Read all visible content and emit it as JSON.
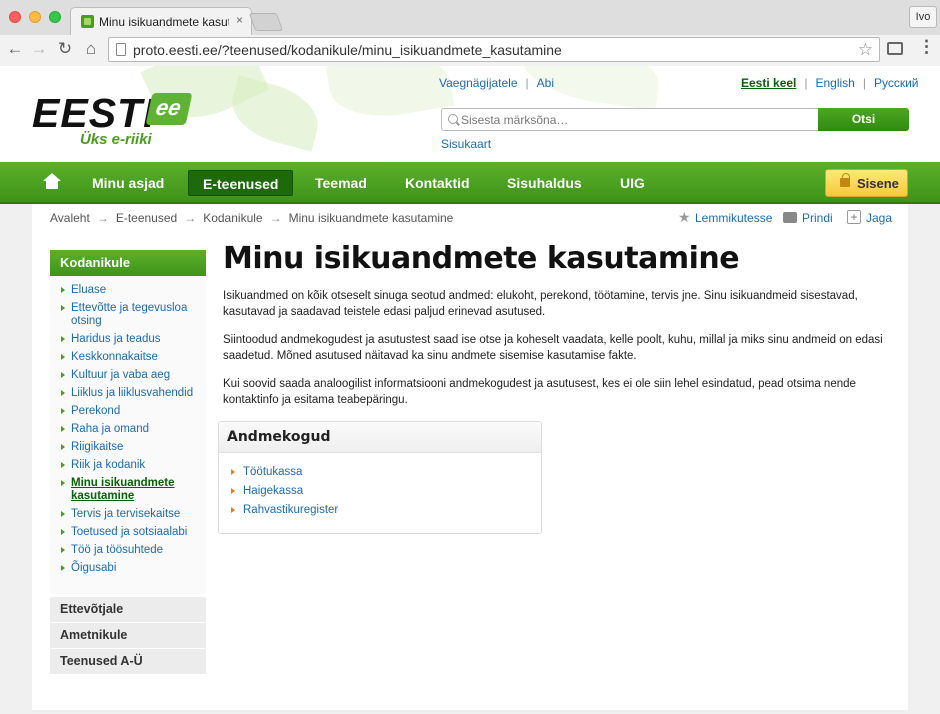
{
  "browser": {
    "tab_title": "Minu isikuandmete kasutam",
    "tab_close": "×",
    "profile": "Ivo",
    "url": "proto.eesti.ee/?teenused/kodanikule/minu_isikuandmete_kasutamine"
  },
  "header": {
    "logo_text": "EESTI",
    "logo_badge": "ee",
    "logo_tagline": "Üks e-riiki",
    "links_left": [
      "Vaegnägijatele",
      "Abi"
    ],
    "languages": [
      "Eesti keel",
      "English",
      "Русский"
    ],
    "search_placeholder": "Sisesta märksõna…",
    "search_button": "Otsi",
    "sitemap": "Sisukaart"
  },
  "nav": {
    "items": [
      "Minu asjad",
      "E-teenused",
      "Teemad",
      "Kontaktid",
      "Sisuhaldus",
      "UIG"
    ],
    "enter": "Sisene"
  },
  "breadcrumb": [
    "Avaleht",
    "E-teenused",
    "Kodanikule",
    "Minu isikuandmete kasutamine"
  ],
  "breadcrumb_sep": "→",
  "utilities": [
    "Lemmikutesse",
    "Prindi",
    "Jaga"
  ],
  "sidebar": {
    "heading": "Kodanikule",
    "items": [
      "Eluase",
      "Ettevõtte ja tegevusloa otsing",
      "Haridus ja teadus",
      "Keskkonnakaitse",
      "Kultuur ja vaba aeg",
      "Liiklus ja liiklusvahendid",
      "Perekond",
      "Raha ja omand",
      "Riigikaitse",
      "Riik ja kodanik",
      "Minu isikuandmete kasutamine",
      "Tervis ja tervisekaitse",
      "Toetused ja sotsiaalabi",
      "Töö ja töösuhtede",
      "Õigusabi"
    ],
    "sections": [
      "Ettevõtjale",
      "Ametnikule",
      "Teenused A-Ü"
    ]
  },
  "main": {
    "title": "Minu isikuandmete kasutamine",
    "paragraphs": [
      "Isikuandmed on kõik otseselt sinuga seotud andmed: elukoht, perekond, töötamine, tervis jne. Sinu isikuandmeid sisestavad, kasutavad ja saadavad teistele edasi paljud erinevad asutused.",
      "Siintoodud andmekogudest ja asutustest saad ise otse ja koheselt vaadata, kelle poolt, kuhu, millal ja miks sinu andmeid on edasi saadetud. Mõned asutused näitavad ka sinu andmete sisemise kasutamise fakte.",
      "Kui soovid saada analoogilist informatsiooni andmekogudest ja asutusest, kes ei ole siin lehel esindatud, pead otsima nende kontaktinfo ja esitama teabepäringu."
    ],
    "datastores": {
      "heading": "Andmekogud",
      "items": [
        "Töötukassa",
        "Haigekassa",
        "Rahvastikuregister"
      ]
    }
  },
  "colors": {
    "brand_green": "#4a9d1f",
    "nav_active": "#1e6a0a",
    "link": "#1d6ab0",
    "enter_button": "#f6c83a",
    "bullet_orange": "#e87d1e"
  }
}
